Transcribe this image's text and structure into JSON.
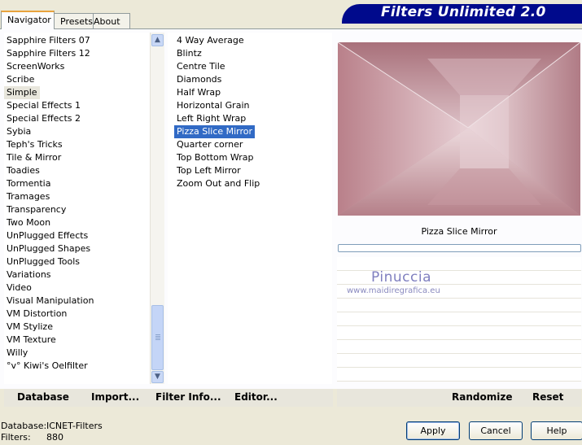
{
  "tabs": [
    {
      "label": "Navigator",
      "active": true
    },
    {
      "label": "Presets",
      "active": false
    },
    {
      "label": "About",
      "active": false
    }
  ],
  "banner": {
    "title": "Filters Unlimited 2.0",
    "color": "#000a8c"
  },
  "categories": {
    "items": [
      "Sapphire Filters 07",
      "Sapphire Filters 12",
      "ScreenWorks",
      "Scribe",
      "Simple",
      "Special Effects 1",
      "Special Effects 2",
      "Sybia",
      "Teph's Tricks",
      "Tile & Mirror",
      "Toadies",
      "Tormentia",
      "Tramages",
      "Transparency",
      "Two Moon",
      "UnPlugged Effects",
      "UnPlugged Shapes",
      "UnPlugged Tools",
      "Variations",
      "Video",
      "Visual Manipulation",
      "VM Distortion",
      "VM Stylize",
      "VM Texture",
      "Willy",
      "°v° Kiwi's Oelfilter"
    ],
    "selected": "Simple",
    "scroll_up_icon": "scroll-up-arrow",
    "scroll_down_icon": "scroll-down-arrow"
  },
  "filters": {
    "items": [
      "4 Way Average",
      "Blintz",
      "Centre Tile",
      "Diamonds",
      "Half Wrap",
      "Horizontal Grain",
      "Left Right Wrap",
      "Pizza Slice Mirror",
      "Quarter corner",
      "Top Bottom Wrap",
      "Top Left Mirror",
      "Zoom Out and Flip"
    ],
    "selected": "Pizza Slice Mirror"
  },
  "preview": {
    "filter_name": "Pizza Slice Mirror",
    "progress": 0,
    "watermark_name": "Pinuccia",
    "watermark_url": "www.maidiregrafica.eu"
  },
  "bottom_toolbar": {
    "database": "Database",
    "import": "Import...",
    "filter_info": "Filter Info...",
    "editor": "Editor...",
    "randomize": "Randomize",
    "reset": "Reset"
  },
  "status": {
    "database_label": "Database:",
    "database_value": "ICNET-Filters",
    "filters_label": "Filters:",
    "filters_value": "880"
  },
  "dialog_buttons": {
    "apply": "Apply",
    "cancel": "Cancel",
    "help": "Help"
  }
}
